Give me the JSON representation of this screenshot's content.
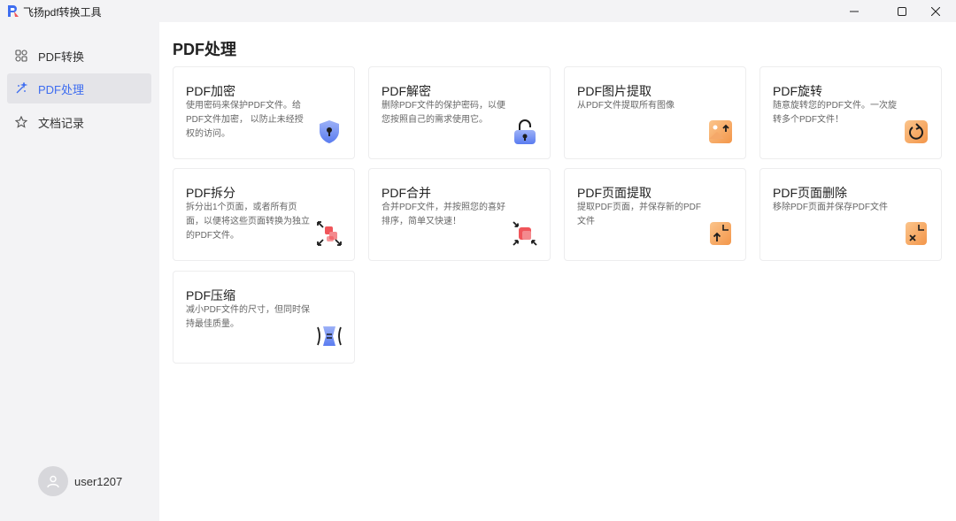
{
  "window": {
    "title": "飞扬pdf转换工具",
    "controls": [
      "minimize-icon",
      "maximize-icon",
      "close-icon"
    ]
  },
  "sidebar": {
    "items": [
      {
        "label": "PDF转换",
        "icon": "convert-icon",
        "active": false
      },
      {
        "label": "PDF处理",
        "icon": "wand-icon",
        "active": true
      },
      {
        "label": "文档记录",
        "icon": "star-icon",
        "active": false
      }
    ],
    "user": {
      "name": "user1207",
      "icon": "user-icon"
    }
  },
  "main": {
    "title": "PDF处理",
    "cards": [
      {
        "title": "PDF加密",
        "desc": "使用密码来保护PDF文件。给PDF文件加密， 以防止未经授权的访问。",
        "icon": "shield-lock-icon"
      },
      {
        "title": "PDF解密",
        "desc": "删除PDF文件的保护密码，以便您按照自己的需求使用它。",
        "icon": "unlock-icon"
      },
      {
        "title": "PDF图片提取",
        "desc": "从PDF文件提取所有图像",
        "icon": "image-extract-icon"
      },
      {
        "title": "PDF旋转",
        "desc": "随意旋转您的PDF文件。一次旋转多个PDF文件！",
        "icon": "rotate-icon"
      },
      {
        "title": "PDF拆分",
        "desc": "拆分出1个页面，或者所有页面，以便将这些页面转换为独立的PDF文件。",
        "icon": "split-icon"
      },
      {
        "title": "PDF合并",
        "desc": "合并PDF文件，并按照您的喜好排序，简单又快速！",
        "icon": "merge-icon"
      },
      {
        "title": "PDF页面提取",
        "desc": "提取PDF页面，并保存新的PDF文件",
        "icon": "page-extract-icon"
      },
      {
        "title": "PDF页面删除",
        "desc": "移除PDF页面并保存PDF文件",
        "icon": "page-delete-icon"
      },
      {
        "title": "PDF压缩",
        "desc": "减小PDF文件的尺寸，但同时保持最佳质量。",
        "icon": "compress-icon"
      }
    ]
  },
  "colors": {
    "accent": "#3e6df0",
    "sidebar_bg": "#f3f3f5",
    "active_bg": "#e4e4e8",
    "card_border": "#ededee",
    "icon_orange": "#f5a15a",
    "icon_red": "#f0555a",
    "icon_blue": "#6f8ef5"
  }
}
